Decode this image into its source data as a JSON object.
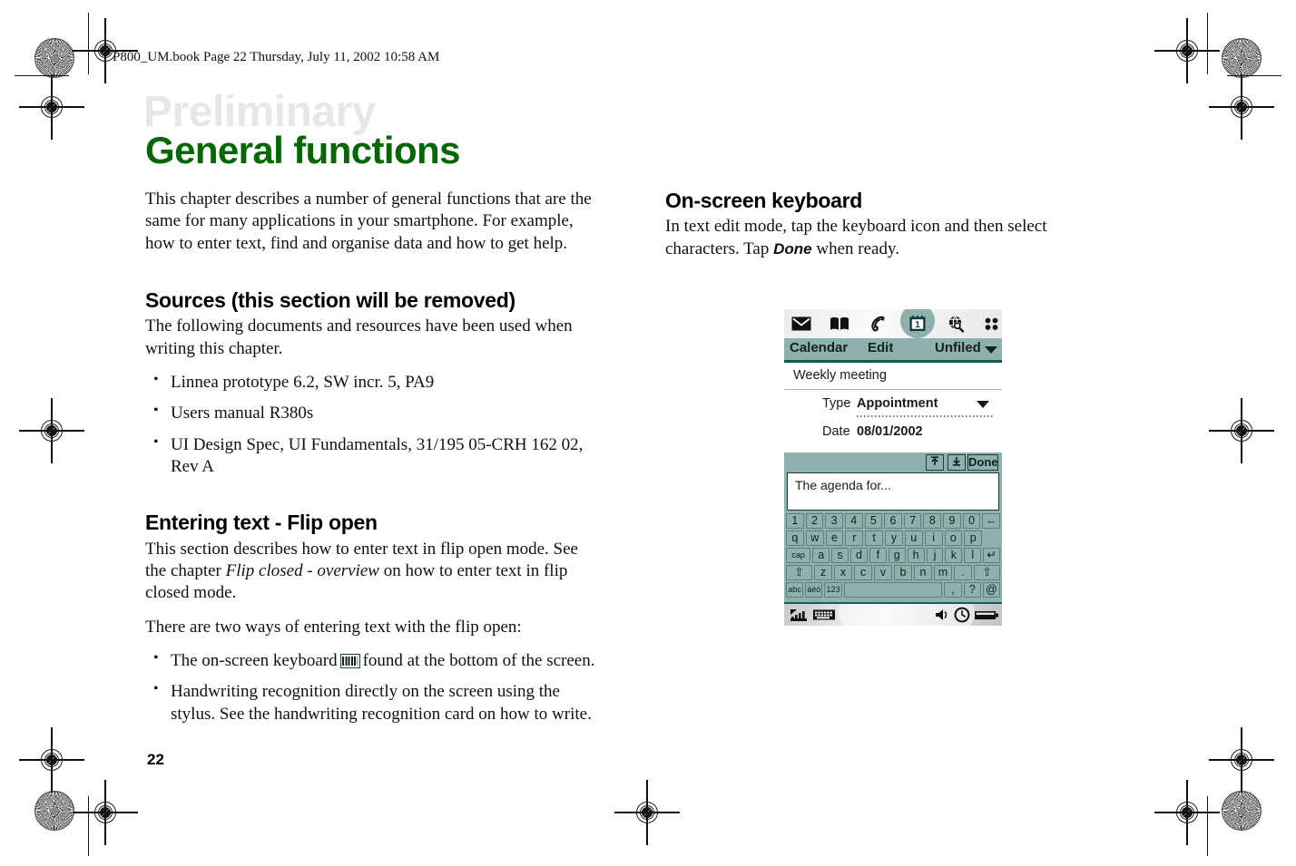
{
  "page": {
    "running_header": "P800_UM.book  Page 22  Thursday, July 11, 2002  10:58 AM",
    "watermark": "Preliminary",
    "chapter_title": "General functions",
    "page_number": "22",
    "accent_green": "#036703",
    "pda_teal": "#8fb0ac",
    "pda_dark_teal": "#11564c"
  },
  "left_column": {
    "intro": "This chapter describes a number of general functions that are the same for many applications in your smartphone. For example, how to enter text, find and organise data and how to get help.",
    "sources": {
      "heading": "Sources (this section will be removed)",
      "paragraph": "The following documents and resources have been used when writing this chapter.",
      "bullets": [
        "Linnea prototype 6.2, SW incr. 5, PA9",
        "Users manual R380s",
        "UI Design Spec, UI Fundamentals, 31/195 05-CRH 162 02, Rev A"
      ]
    },
    "entering_text": {
      "heading": "Entering text - Flip open",
      "paragraph_1_part_1": "This section describes how to enter text in flip open mode. See the chapter ",
      "paragraph_1_italic": "Flip closed - overview",
      "paragraph_1_part_2": " on how to enter text in flip closed mode.",
      "paragraph_2": "There are two ways of entering text with the flip open:",
      "bullet_1_part_1": "The on-screen keyboard",
      "bullet_1_part_2": "found at the bottom of the screen.",
      "bullet_2": "Handwriting recognition directly on the screen using the stylus. See the handwriting recognition card on how to write."
    }
  },
  "right_column": {
    "heading": "On-screen keyboard",
    "paragraph_part_1": "In text edit mode, tap the keyboard icon and then select characters. Tap ",
    "paragraph_bold": "Done",
    "paragraph_part_2": " when ready."
  },
  "pda": {
    "iconbar": [
      {
        "name": "envelope-icon",
        "label": "Messaging"
      },
      {
        "name": "book-icon",
        "label": "Contacts"
      },
      {
        "name": "phone-icon",
        "label": "Phone"
      },
      {
        "name": "calendar-icon",
        "label": "Calendar",
        "selected": true,
        "day": "1"
      },
      {
        "name": "find-icon",
        "label": "Find"
      },
      {
        "name": "apps-icon",
        "label": "More applications"
      }
    ],
    "menubar": {
      "app": "Calendar",
      "edit": "Edit",
      "folder": "Unfiled"
    },
    "record": {
      "title": "Weekly meeting",
      "type_label": "Type",
      "type_value": "Appointment",
      "date_label": "Date",
      "date_value": "08/01/2002"
    },
    "keyboard_panel": {
      "scroll_up_label": "↑",
      "scroll_down_label": "↓",
      "done_label": "Done",
      "text_value": "The agenda for...",
      "rows": [
        [
          "1",
          "2",
          "3",
          "4",
          "5",
          "6",
          "7",
          "8",
          "9",
          "0",
          "←"
        ],
        [
          "q",
          "w",
          "e",
          "r",
          "t",
          "y",
          "u",
          "i",
          "o",
          "p",
          "↵"
        ],
        [
          "cap",
          "a",
          "s",
          "d",
          "f",
          "g",
          "h",
          "j",
          "k",
          "l"
        ],
        [
          "⇧",
          "z",
          "x",
          "c",
          "v",
          "b",
          "n",
          "m",
          ".",
          "⇧"
        ],
        [
          "abc",
          "àéó",
          "123",
          "",
          "",
          ",",
          "?",
          "@"
        ]
      ]
    },
    "statusbar": {
      "signal": "signal-strength-icon",
      "keyboard": "keyboard-icon",
      "speaker": "speaker-icon",
      "clock": "clock-icon",
      "battery": "battery-icon"
    }
  }
}
